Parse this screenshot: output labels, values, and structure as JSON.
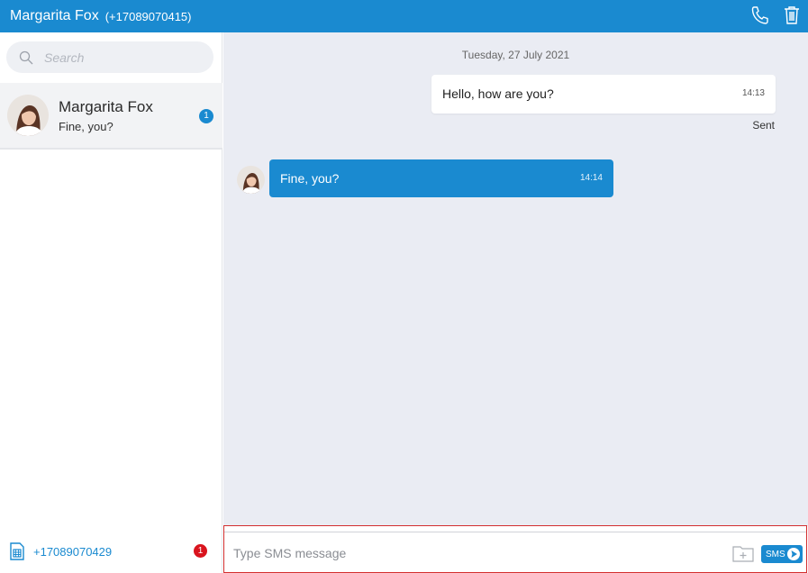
{
  "header": {
    "contact_name": "Margarita Fox",
    "contact_number": "(+17089070415)",
    "bg_color": "#1a8ad0",
    "icons": [
      "phone-icon",
      "trash-icon"
    ]
  },
  "sidebar": {
    "search": {
      "placeholder": "Search"
    },
    "conversations": [
      {
        "name": "Margarita Fox",
        "preview": "Fine, you?",
        "unread": "1"
      }
    ],
    "footer": {
      "my_number": "+17089070429",
      "unread": "1"
    }
  },
  "chat": {
    "date": "Tuesday, 27 July 2021",
    "messages": [
      {
        "direction": "out",
        "text": "Hello, how are you?",
        "time": "14:13",
        "status": "Sent"
      },
      {
        "direction": "in",
        "text": "Fine, you?",
        "time": "14:14"
      }
    ]
  },
  "composer": {
    "placeholder": "Type SMS message",
    "send_label": "SMS"
  }
}
